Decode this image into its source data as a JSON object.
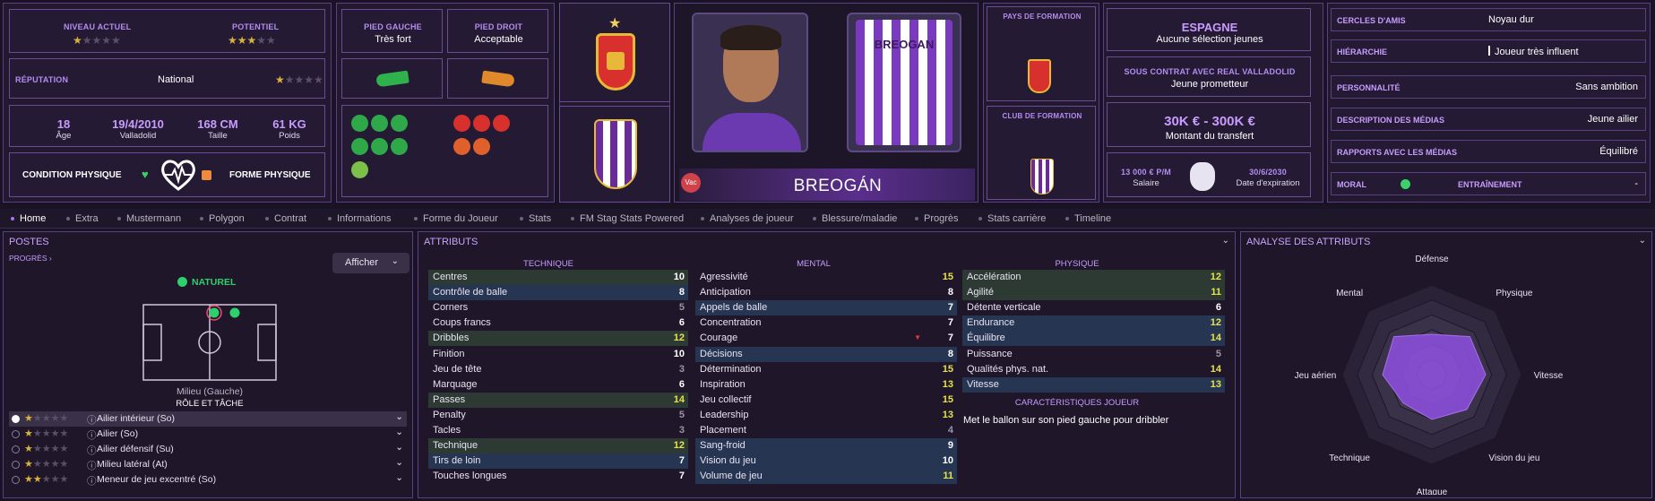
{
  "level": {
    "current_label": "NIVEAU ACTUEL",
    "potential_label": "POTENTIEL",
    "current_stars": 1.5,
    "potential_stars": 2.5
  },
  "reputation": {
    "label": "RÉPUTATION",
    "value": "National",
    "stars": 0.5
  },
  "bio": {
    "age": "18",
    "age_label": "Âge",
    "dob": "19/4/2010",
    "birthplace": "Valladolid",
    "height": "168 CM",
    "height_label": "Taille",
    "weight": "61 KG",
    "weight_label": "Poids"
  },
  "condition": {
    "label": "CONDITION PHYSIQUE",
    "forme_label": "FORME PHYSIQUE"
  },
  "feet": {
    "left_label": "PIED GAUCHE",
    "left_value": "Très fort",
    "right_label": "PIED DROIT",
    "right_value": "Acceptable"
  },
  "player": {
    "name": "BREOGÁN",
    "shirt_name": "BREOGAN",
    "vac": "Vac"
  },
  "formation": {
    "country_label": "PAYS DE FORMATION",
    "club_label": "CLUB DE FORMATION"
  },
  "nation": {
    "name": "ESPAGNE",
    "selections": "Aucune sélection jeunes"
  },
  "contract": {
    "label": "SOUS CONTRAT AVEC REAL VALLADOLID",
    "status": "Jeune prometteur"
  },
  "transfer": {
    "value": "30K € - 300K €",
    "label": "Montant du transfert"
  },
  "wage": {
    "value": "13 000 € P/M",
    "label": "Salaire",
    "expiry": "30/6/2030",
    "expiry_label": "Date d'expiration"
  },
  "personal": [
    {
      "k": "CERCLES D'AMIS",
      "v": "Noyau dur"
    },
    {
      "k": "HIÉRARCHIE",
      "v": "Joueur très influent"
    },
    {
      "k": "PERSONNALITÉ",
      "v": "Sans ambition"
    },
    {
      "k": "DESCRIPTION DES MÉDIAS",
      "v": "Jeune ailier"
    },
    {
      "k": "RAPPORTS AVEC LES MÉDIAS",
      "v": "Équilibré"
    }
  ],
  "morale": {
    "label": "MORAL",
    "training_label": "ENTRAÎNEMENT",
    "training_value": "-"
  },
  "tabs": [
    "Home",
    "Extra",
    "Mustermann",
    "Polygon",
    "Contrat",
    "Informations",
    "Forme du Joueur",
    "Stats",
    "FM Stag Stats Powered",
    "Analyses de joueur",
    "Blessure/maladie",
    "Progrès",
    "Stats carrière",
    "Timeline"
  ],
  "postes": {
    "title": "POSTES",
    "progress": "PROGRÈS",
    "show_btn": "Afficher",
    "natural": "NATUREL",
    "position": "Milieu (Gauche)",
    "role_task": "RÔLE ET TÂCHE",
    "roles": [
      {
        "stars": 1.5,
        "name": "Ailier intérieur (So)"
      },
      {
        "stars": 1.5,
        "name": "Ailier (So)"
      },
      {
        "stars": 1.5,
        "name": "Ailier défensif (Su)"
      },
      {
        "stars": 1,
        "name": "Milieu latéral (At)"
      },
      {
        "stars": 2,
        "name": "Meneur de jeu excentré (So)"
      }
    ]
  },
  "attributes": {
    "title": "ATTRIBUTS",
    "tech_label": "TECHNIQUE",
    "mental_label": "MENTAL",
    "phys_label": "PHYSIQUE",
    "traits_label": "CARACTÉRISTIQUES JOUEUR",
    "trait": "Met le ballon sur son pied gauche pour dribbler",
    "technique": [
      {
        "n": "Centres",
        "v": "10",
        "hl": "green",
        "c": "w"
      },
      {
        "n": "Contrôle de balle",
        "v": "8",
        "hl": "blue",
        "c": "w"
      },
      {
        "n": "Corners",
        "v": "5",
        "hl": "",
        "c": "g"
      },
      {
        "n": "Coups francs",
        "v": "6",
        "hl": "",
        "c": "w"
      },
      {
        "n": "Dribbles",
        "v": "12",
        "hl": "green",
        "c": "y"
      },
      {
        "n": "Finition",
        "v": "10",
        "hl": "",
        "c": "w"
      },
      {
        "n": "Jeu de tête",
        "v": "3",
        "hl": "",
        "c": "g"
      },
      {
        "n": "Marquage",
        "v": "6",
        "hl": "",
        "c": "w"
      },
      {
        "n": "Passes",
        "v": "14",
        "hl": "green",
        "c": "y"
      },
      {
        "n": "Penalty",
        "v": "5",
        "hl": "",
        "c": "g"
      },
      {
        "n": "Tacles",
        "v": "3",
        "hl": "",
        "c": "g"
      },
      {
        "n": "Technique",
        "v": "12",
        "hl": "green",
        "c": "y"
      },
      {
        "n": "Tirs de loin",
        "v": "7",
        "hl": "blue",
        "c": "w"
      },
      {
        "n": "Touches longues",
        "v": "7",
        "hl": "",
        "c": "w"
      }
    ],
    "mental": [
      {
        "n": "Agressivité",
        "v": "15",
        "hl": "",
        "c": "y"
      },
      {
        "n": "Anticipation",
        "v": "8",
        "hl": "",
        "c": "w"
      },
      {
        "n": "Appels de balle",
        "v": "7",
        "hl": "blue",
        "c": "w"
      },
      {
        "n": "Concentration",
        "v": "7",
        "hl": "",
        "c": "w"
      },
      {
        "n": "Courage",
        "v": "7",
        "hl": "",
        "c": "w",
        "down": true
      },
      {
        "n": "Décisions",
        "v": "8",
        "hl": "blue",
        "c": "w"
      },
      {
        "n": "Détermination",
        "v": "15",
        "hl": "",
        "c": "y"
      },
      {
        "n": "Inspiration",
        "v": "13",
        "hl": "",
        "c": "y"
      },
      {
        "n": "Jeu collectif",
        "v": "15",
        "hl": "",
        "c": "y"
      },
      {
        "n": "Leadership",
        "v": "13",
        "hl": "",
        "c": "y"
      },
      {
        "n": "Placement",
        "v": "4",
        "hl": "",
        "c": "g"
      },
      {
        "n": "Sang-froid",
        "v": "9",
        "hl": "blue",
        "c": "w"
      },
      {
        "n": "Vision du jeu",
        "v": "10",
        "hl": "blue",
        "c": "w"
      },
      {
        "n": "Volume de jeu",
        "v": "11",
        "hl": "blue",
        "c": "y"
      }
    ],
    "physique": [
      {
        "n": "Accélération",
        "v": "12",
        "hl": "green",
        "c": "y"
      },
      {
        "n": "Agilité",
        "v": "11",
        "hl": "green",
        "c": "y"
      },
      {
        "n": "Détente verticale",
        "v": "6",
        "hl": "",
        "c": "w"
      },
      {
        "n": "Endurance",
        "v": "12",
        "hl": "blue",
        "c": "y"
      },
      {
        "n": "Équilibre",
        "v": "14",
        "hl": "blue",
        "c": "y"
      },
      {
        "n": "Puissance",
        "v": "5",
        "hl": "",
        "c": "g"
      },
      {
        "n": "Qualités phys. nat.",
        "v": "14",
        "hl": "",
        "c": "y"
      },
      {
        "n": "Vitesse",
        "v": "13",
        "hl": "blue",
        "c": "y"
      }
    ]
  },
  "analysis": {
    "title": "ANALYSE DES ATTRIBUTS",
    "axes": [
      "Défense",
      "Physique",
      "Vitesse",
      "Vision du jeu",
      "Attaque",
      "Technique",
      "Jeu aérien",
      "Mental"
    ],
    "values": [
      0.45,
      0.6,
      0.6,
      0.55,
      0.5,
      0.45,
      0.55,
      0.6
    ]
  }
}
